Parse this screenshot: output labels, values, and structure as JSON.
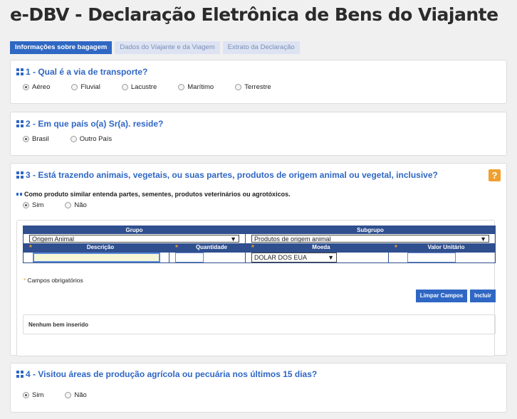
{
  "title": "e-DBV - Declaração Eletrônica de Bens do Viajante",
  "tabs": [
    {
      "label": "Informações sobre bagagem",
      "active": true
    },
    {
      "label": "Dados do Viajante e da Viagem",
      "active": false
    },
    {
      "label": "Extrato da Declaração",
      "active": false
    }
  ],
  "q1": {
    "title": "1 - Qual é a via de transporte?",
    "options": [
      "Aéreo",
      "Fluvial",
      "Lacustre",
      "Marítimo",
      "Terrestre"
    ],
    "selected": "Aéreo"
  },
  "q2": {
    "title": "2 - Em que país o(a) Sr(a). reside?",
    "options": [
      "Brasil",
      "Outro País"
    ],
    "selected": "Brasil"
  },
  "q3": {
    "title": "3 - Está trazendo animais, vegetais, ou suas partes, produtos de origem animal ou vegetal, inclusive?",
    "help_icon": "?",
    "note": "Como produto similar entenda partes, sementes, produtos veterinários ou agrotóxicos.",
    "options": [
      "Sim",
      "Não"
    ],
    "selected": "Sim",
    "table": {
      "grupo_header": "Grupo",
      "subgrupo_header": "Subgrupo",
      "grupo_value": "Origem Animal",
      "subgrupo_value": "Produtos de origem animal",
      "descricao_header": "Descrição",
      "quantidade_header": "Quantidade",
      "moeda_header": "Moeda",
      "valor_header": "Valor Unitário",
      "moeda_value": "DOLAR DOS EUA",
      "descricao_value": "",
      "quantidade_value": "",
      "valor_value": ""
    },
    "required_star": "*",
    "required_note": "Campos obrigatórios",
    "clear_button": "Limpar Campos",
    "add_button": "Incluir",
    "empty_message": "Nenhum bem inserido"
  },
  "q4": {
    "title": "4 - Visitou áreas de produção agrícola ou pecuária nos últimos 15 dias?",
    "options": [
      "Sim",
      "Não"
    ],
    "selected": "Sim"
  },
  "colors": {
    "accent": "#2f67c4",
    "header": "#2f4f8f",
    "warning": "#f0a030"
  }
}
